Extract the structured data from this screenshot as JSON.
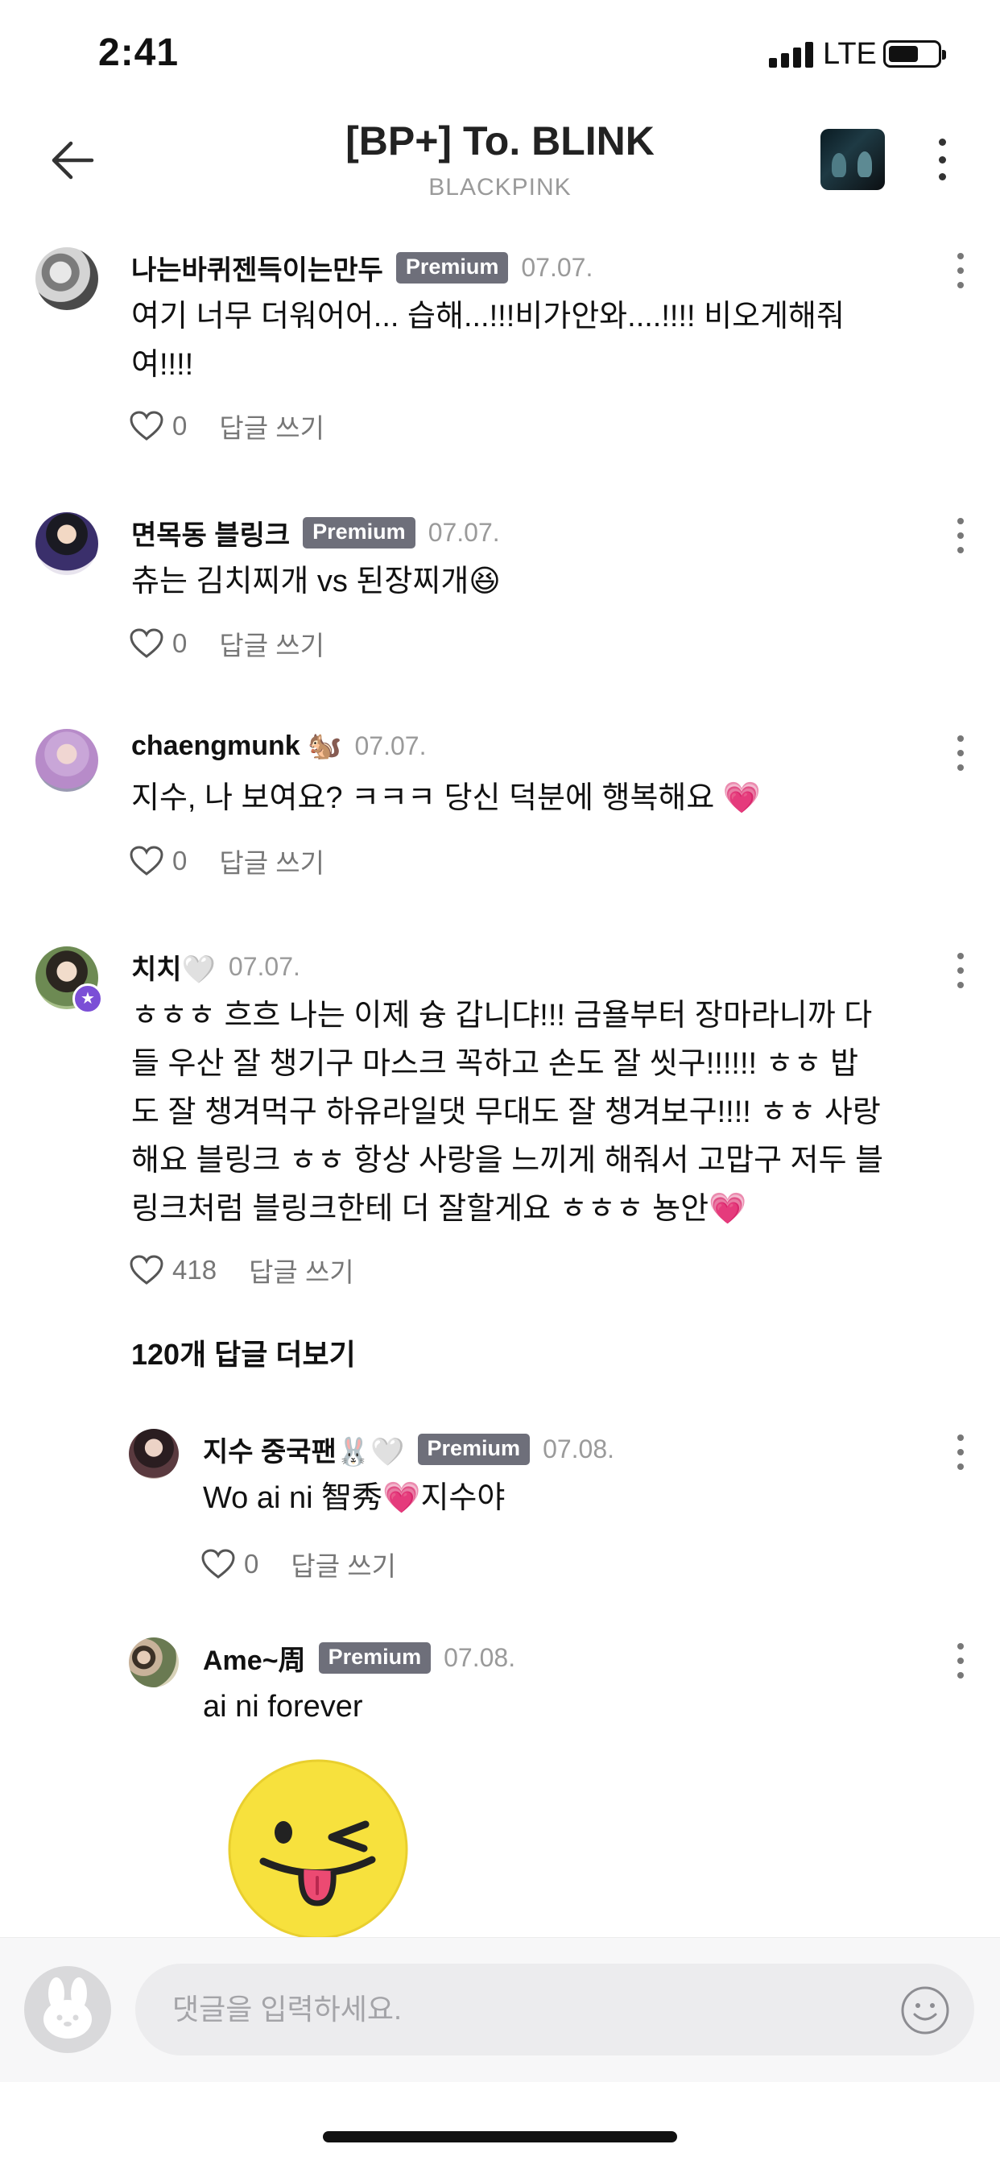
{
  "status_bar": {
    "time": "2:41",
    "network": "LTE"
  },
  "header": {
    "title": "[BP+] To. BLINK",
    "subtitle": "BLACKPINK"
  },
  "reply_label": "답글 쓰기",
  "comments": [
    {
      "author": "나는바퀴젠득이는만두",
      "badge": "Premium",
      "date": "07.07.",
      "text": "여기 너무 더워어어... 습해...!!!비가안와....!!!! 비오게해줘\n여!!!!",
      "likes": "0"
    },
    {
      "author": "면목동 블링크",
      "badge": "Premium",
      "date": "07.07.",
      "text": "츄는 김치찌개 vs 된장찌개😆",
      "likes": "0"
    },
    {
      "author": "chaengmunk 🐿️",
      "date": "07.07.",
      "text": "지수, 나 보여요? ㅋㅋㅋ 당신 덕분에 행복해요 💗",
      "likes": "0"
    },
    {
      "author": "치치🤍",
      "date": "07.07.",
      "text": "ㅎㅎㅎ 흐흐 나는 이제 슝 갑니댜!!! 금욜부터 장마라니까 다\n들 우산 잘 챙기구 마스크 꼭하고 손도 잘 씻구!!!!!! ㅎㅎ 밥\n도 잘 챙겨먹구 하유라일댓 무대도 잘 챙겨보구!!!! ㅎㅎ 사랑\n해요 블링크 ㅎㅎ 항상 사랑을 느끼게 해줘서 고맙구 저두 블\n링크처럼 블링크한테 더 잘할게요 ㅎㅎㅎ 뇽안💗",
      "likes": "418"
    }
  ],
  "more_replies": "120개 답글 더보기",
  "replies": [
    {
      "author": "지수 중국팬🐰🤍",
      "badge": "Premium",
      "date": "07.08.",
      "text": "Wo ai ni 智秀💗지수야",
      "likes": "0"
    },
    {
      "author": "Ame~周",
      "badge": "Premium",
      "date": "07.08.",
      "text": "ai ni forever"
    }
  ],
  "input": {
    "placeholder": "댓글을 입력하세요."
  },
  "colors": {
    "badge": "#6e6f7a",
    "date": "#9a9a9a",
    "accent_purple": "#7b4fd6",
    "sticker_yellow": "#f7e13d"
  }
}
